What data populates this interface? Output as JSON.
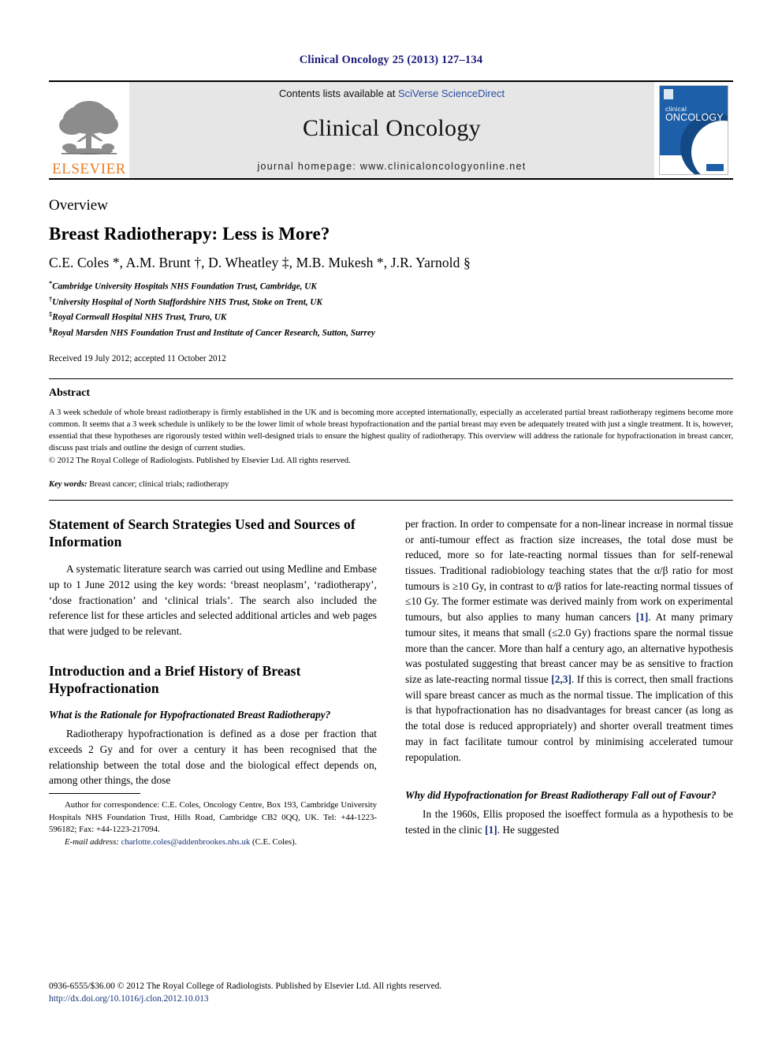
{
  "running_head": "Clinical Oncology 25 (2013) 127–134",
  "masthead": {
    "publisher_name": "ELSEVIER",
    "contents_prefix": "Contents lists available at ",
    "contents_link": "SciVerse ScienceDirect",
    "journal_title": "Clinical Oncology",
    "homepage": "journal homepage: www.clinicaloncologyonline.net",
    "cover_line1": "clinical",
    "cover_line2": "ONCOLOGY"
  },
  "article": {
    "doctype": "Overview",
    "title": "Breast Radiotherapy: Less is More?",
    "authors": "C.E. Coles *, A.M. Brunt †, D. Wheatley ‡, M.B. Mukesh *, J.R. Yarnold §",
    "affiliations": [
      {
        "marker": "*",
        "text": "Cambridge University Hospitals NHS Foundation Trust, Cambridge, UK"
      },
      {
        "marker": "†",
        "text": "University Hospital of North Staffordshire NHS Trust, Stoke on Trent, UK"
      },
      {
        "marker": "‡",
        "text": "Royal Cornwall Hospital NHS Trust, Truro, UK"
      },
      {
        "marker": "§",
        "text": "Royal Marsden NHS Foundation Trust and Institute of Cancer Research, Sutton, Surrey"
      }
    ],
    "history": "Received 19 July 2012; accepted 11 October 2012"
  },
  "abstract": {
    "heading": "Abstract",
    "text": "A 3 week schedule of whole breast radiotherapy is firmly established in the UK and is becoming more accepted internationally, especially as accelerated partial breast radiotherapy regimens become more common. It seems that a 3 week schedule is unlikely to be the lower limit of whole breast hypofractionation and the partial breast may even be adequately treated with just a single treatment. It is, however, essential that these hypotheses are rigorously tested within well-designed trials to ensure the highest quality of radiotherapy. This overview will address the rationale for hypofractionation in breast cancer, discuss past trials and outline the design of current studies.",
    "copyright": "© 2012 The Royal College of Radiologists. Published by Elsevier Ltd. All rights reserved.",
    "keywords_label": "Key words:",
    "keywords": "Breast cancer; clinical trials; radiotherapy"
  },
  "left_column": {
    "section1_heading": "Statement of Search Strategies Used and Sources of Information",
    "section1_para": "A systematic literature search was carried out using Medline and Embase up to 1 June 2012 using the key words: ‘breast neoplasm’, ‘radiotherapy’, ‘dose fractionation’ and ‘clinical trials’. The search also included the reference list for these articles and selected additional articles and web pages that were judged to be relevant.",
    "section2_heading": "Introduction and a Brief History of Breast Hypofractionation",
    "section2_sub": "What is the Rationale for Hypofractionated Breast Radiotherapy?",
    "section2_para": "Radiotherapy hypofractionation is defined as a dose per fraction that exceeds 2 Gy and for over a century it has been recognised that the relationship between the total dose and the biological effect depends on, among other things, the dose"
  },
  "right_column": {
    "para1_a": "per fraction. In order to compensate for a non-linear increase in normal tissue or anti-tumour effect as fraction size increases, the total dose must be reduced, more so for late-reacting normal tissues than for self-renewal tissues. Traditional radiobiology teaching states that the α/β ratio for most tumours is ≥10 Gy, in contrast to α/β ratios for late-reacting normal tissues of ≤10 Gy. The former estimate was derived mainly from work on experimental tumours, but also applies to many human cancers ",
    "cite1": "[1]",
    "para1_b": ". At many primary tumour sites, it means that small (≤2.0 Gy) fractions spare the normal tissue more than the cancer. More than half a century ago, an alternative hypothesis was postulated suggesting that breast cancer may be as sensitive to fraction size as late-reacting normal tissue ",
    "cite2": "[2,3]",
    "para1_c": ". If this is correct, then small fractions will spare breast cancer as much as the normal tissue. The implication of this is that hypofractionation has no disadvantages for breast cancer (as long as the total dose is reduced appropriately) and shorter overall treatment times may in fact facilitate tumour control by minimising accelerated tumour repopulation.",
    "sub1": "Why did Hypofractionation for Breast Radiotherapy Fall out of Favour?",
    "para2_a": "In the 1960s, Ellis proposed the isoeffect formula as a hypothesis to be tested in the clinic ",
    "cite3": "[1]",
    "para2_b": ". He suggested"
  },
  "footnote": {
    "correspondence": "Author for correspondence: C.E. Coles, Oncology Centre, Box 193, Cambridge University Hospitals NHS Foundation Trust, Hills Road, Cambridge CB2 0QQ, UK. Tel: +44-1223-596182; Fax: +44-1223-217094.",
    "email_label": "E-mail address:",
    "email": "charlotte.coles@addenbrookes.nhs.uk",
    "email_suffix": " (C.E. Coles)."
  },
  "page_footer": {
    "issn_line": "0936-6555/$36.00 © 2012 The Royal College of Radiologists. Published by Elsevier Ltd. All rights reserved.",
    "doi": "http://dx.doi.org/10.1016/j.clon.2012.10.013"
  }
}
